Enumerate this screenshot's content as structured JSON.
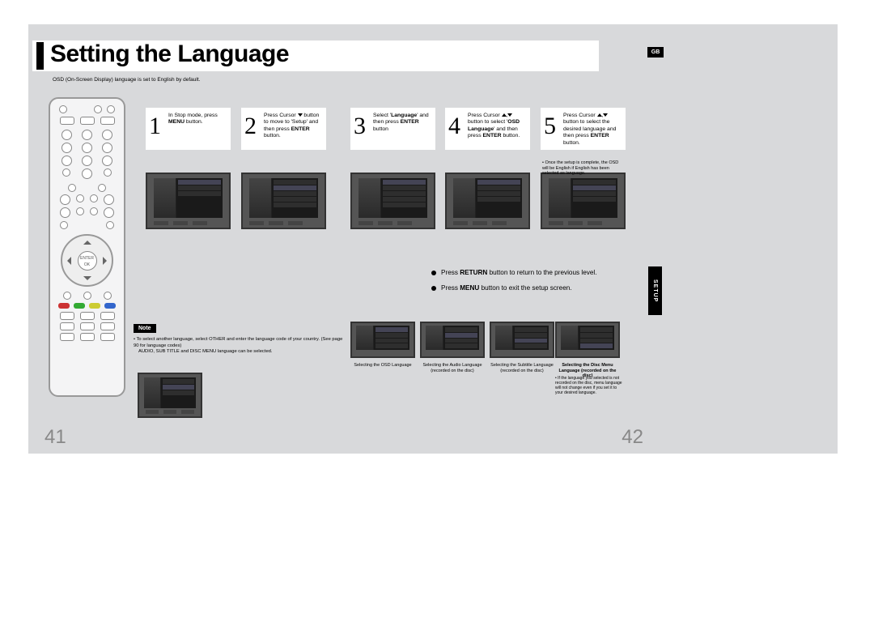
{
  "header": {
    "title": "Setting the Language",
    "subtitle": "OSD (On-Screen Display) language is set to English by default.",
    "region_badge": "GB"
  },
  "steps": [
    {
      "num": "1",
      "text_html": "In Stop mode, press <b>MENU</b> button."
    },
    {
      "num": "2",
      "text_html": "Press Cursor ▼ button to move to 'Setup' and then press <b>ENTER</b> button."
    },
    {
      "num": "3",
      "text_html": "Select '<b>Language</b>' and then press <b>ENTER</b> button"
    },
    {
      "num": "4",
      "text_html": "Press Cursor ▲,▼ button to select '<b>OSD Language</b>' and then press <b>ENTER</b> button."
    },
    {
      "num": "5",
      "text_html": "Press Cursor ▲,▼ button to select the desired language and then press <b>ENTER</b> button."
    }
  ],
  "step5_note": "• Once the setup is complete, the OSD will be English if English has been selected as language.",
  "info": {
    "line1_html": "Press <b>RETURN</b> button to return to the previous level.",
    "line2_html": "Press <b>MENU</b> button to exit the setup screen."
  },
  "setup_tab": "SETUP",
  "note": {
    "badge": "Note",
    "bullet1": "• To select another language, select OTHER and enter the language code of your country. (See page 90 for language codes)",
    "bullet2": "AUDIO, SUB TITLE and DISC MENU language can be selected."
  },
  "bottom_steps": [
    {
      "label": "Selecting the OSD Language"
    },
    {
      "label": "Selecting the Audio Language (recorded on the disc)"
    },
    {
      "label": "Selecting the Subtitle Language (recorded on the disc)"
    },
    {
      "label": "Selecting the Disc Menu Language (recorded on the disc)"
    }
  ],
  "bottom_note": "• If the language you selected is not recorded on the disc, menu language will not change even if you set it to your desired language.",
  "page_numbers": {
    "left": "41",
    "right": "42"
  },
  "remote": {
    "center_label": "ENTER OK"
  }
}
